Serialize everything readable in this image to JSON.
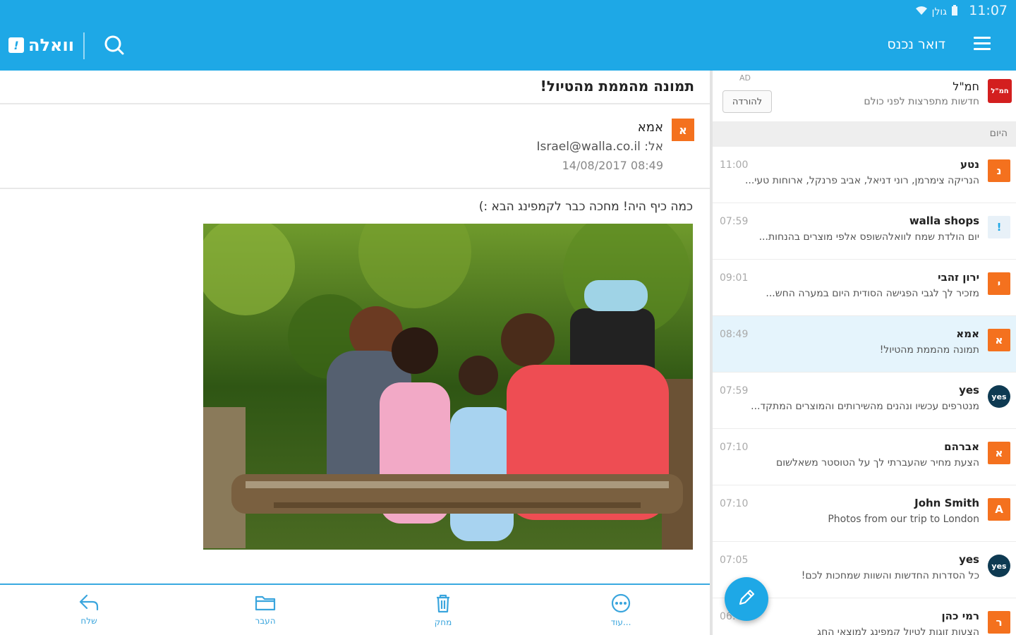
{
  "status_bar": {
    "time": "11:07",
    "carrier": "גולן"
  },
  "app_bar": {
    "logo_text": "וואלה",
    "logo_badge": "!",
    "folder_title": "דואר נכנס",
    "icons": {
      "search": "search-icon",
      "menu": "hamburger-menu-icon"
    }
  },
  "reader": {
    "subject": "תמונה מהממת מהטיול!",
    "sender_initial": "א",
    "sender_name": "אמא",
    "to_line": "אל: Israel@walla.co.il",
    "date": "14/08/2017 08:49",
    "body": "כמה כיף היה! מחכה כבר לקמפינג הבא :)",
    "photo_alt": "family-photo"
  },
  "toolbar": {
    "reply": "שלח",
    "move": "העבר",
    "delete": "מחק",
    "more": "עוד..."
  },
  "ad": {
    "tag": "AD",
    "logo": "חמ\"ל",
    "title": "חמ\"ל",
    "description": "חדשות מתפרצות לפני כולם",
    "button": "להורדה"
  },
  "section_today": "היום",
  "messages": [
    {
      "initial": "נ",
      "from": "נטע",
      "snippet": "הנריקה צימרמן, רוני דניאל, אביב פרנקל, ארוחות טעי...",
      "time": "11:00",
      "color": "#f4711e",
      "selected": false
    },
    {
      "initial": "!",
      "from": "walla shops",
      "snippet": "יום הולדת שמח לוואלהשופס אלפי מוצרים בהנחות...",
      "time": "07:59",
      "color": "#e8f1f8",
      "selected": false
    },
    {
      "initial": "י",
      "from": "ירון זהבי",
      "snippet": "מזכיר לך לגבי הפגישה הסודית היום במערה החש...",
      "time": "09:01",
      "color": "#f4711e",
      "selected": false
    },
    {
      "initial": "א",
      "from": "אמא",
      "snippet": "תמונה מהממת מהטיול!",
      "time": "08:49",
      "color": "#f4711e",
      "selected": true
    },
    {
      "initial": "yes",
      "from": "yes",
      "snippet": "מנטרפים עכשיו ונהנים מהשירותים והמוצרים המתקד...",
      "time": "07:59",
      "color": "#0e3a52",
      "selected": false
    },
    {
      "initial": "א",
      "from": "אברהם",
      "snippet": "הצעת מחיר שהעברתי לך על הטוסטר משאלשום",
      "time": "07:10",
      "color": "#f4711e",
      "selected": false
    },
    {
      "initial": "A",
      "from": "John Smith",
      "snippet": "Photos from our trip to London",
      "time": "07:10",
      "color": "#f4711e",
      "selected": false
    },
    {
      "initial": "yes",
      "from": "yes",
      "snippet": "כל הסדרות החדשות והשוות שמחכות לכם!",
      "time": "07:05",
      "color": "#0e3a52",
      "selected": false
    },
    {
      "initial": "ר",
      "from": "רמי כהן",
      "snippet": "הצעות זוגות לטיול קמפינג למוצאי החג",
      "time": "06:40",
      "color": "#f4711e",
      "selected": false
    }
  ]
}
